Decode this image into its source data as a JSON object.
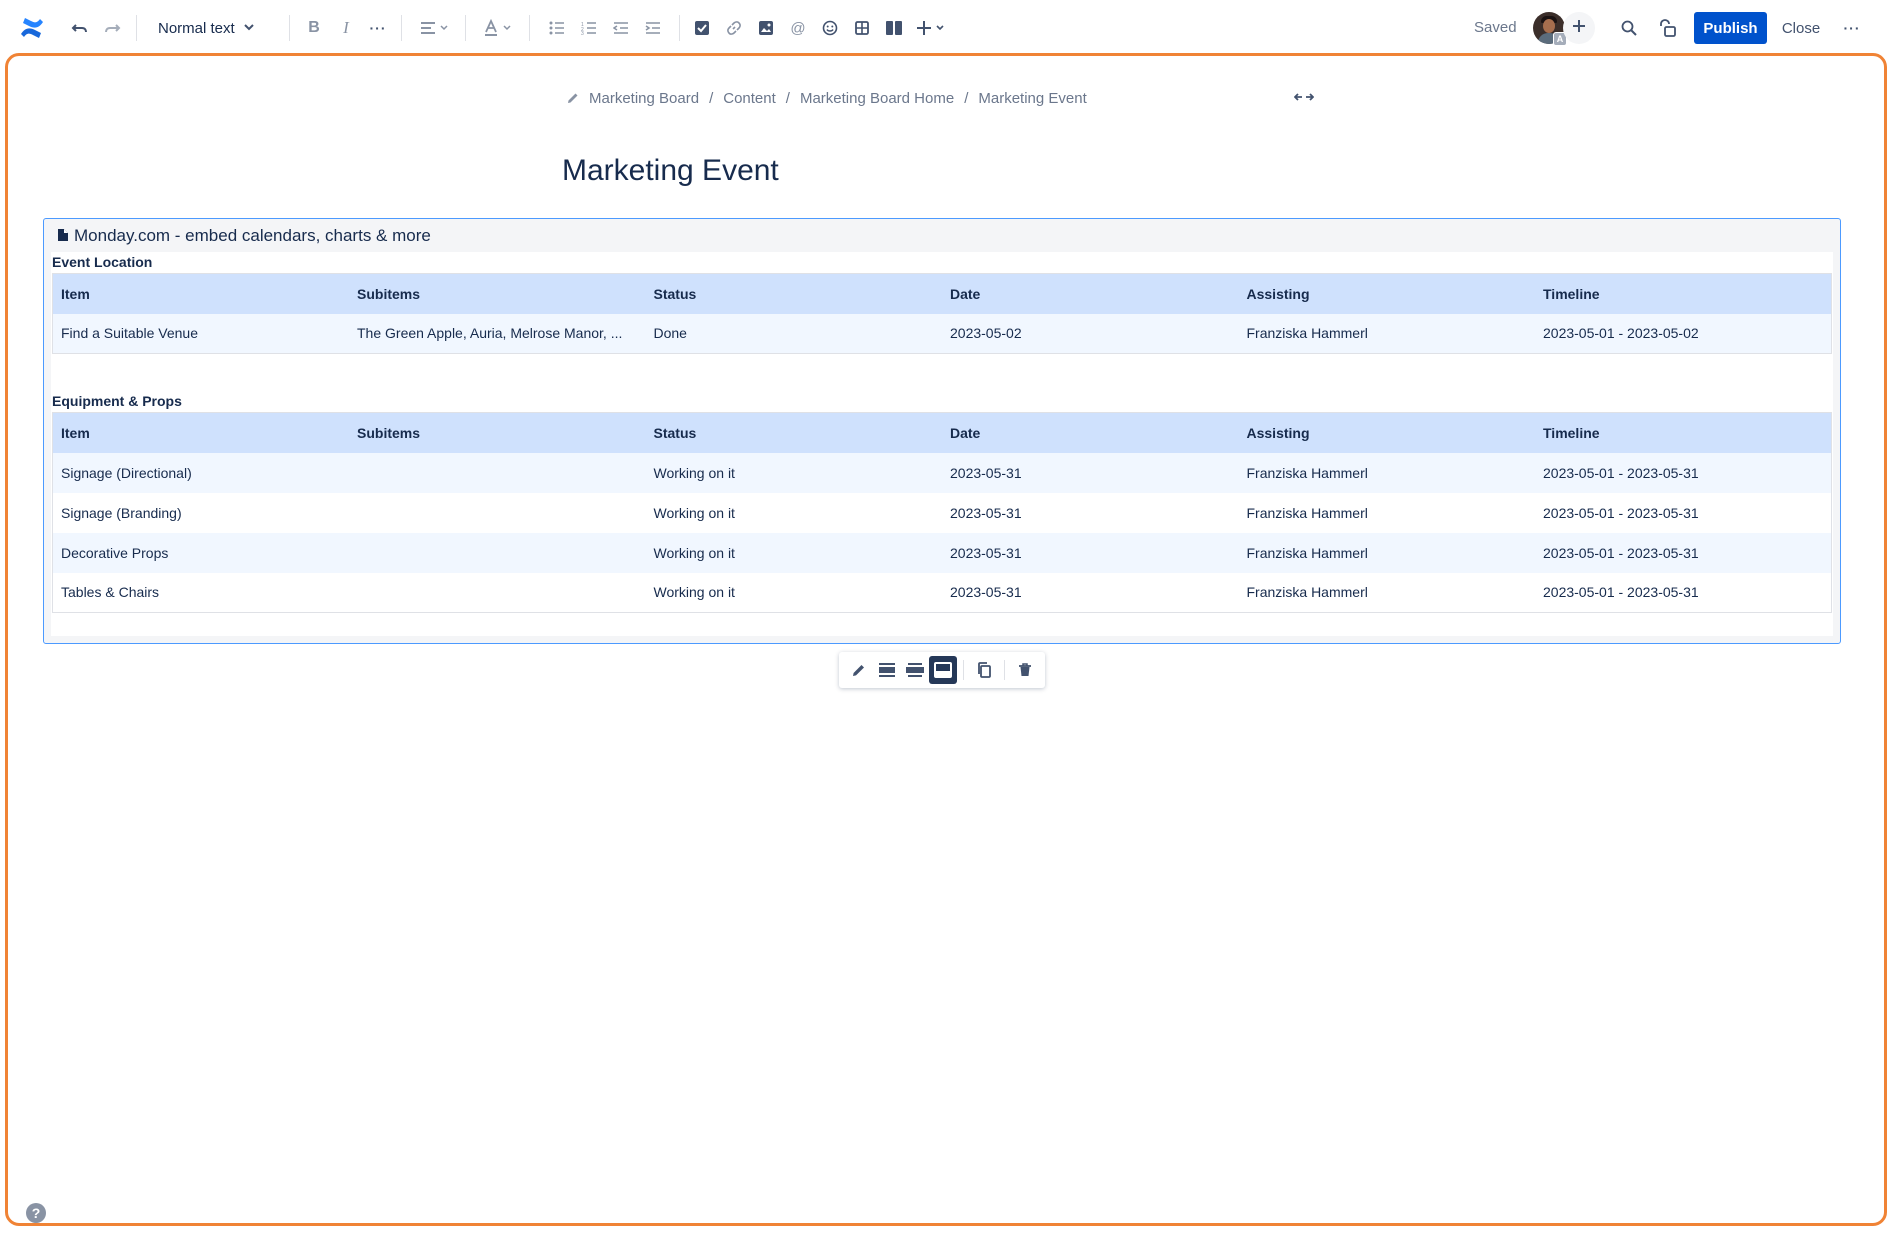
{
  "toolbar": {
    "text_style": "Normal text",
    "saved_label": "Saved",
    "publish_label": "Publish",
    "close_label": "Close",
    "avatar_badge": "A",
    "icons": [
      "confluence-logo-icon",
      "undo-icon",
      "redo-icon",
      "bold-icon",
      "italic-icon",
      "more-formatting-icon",
      "align-icon",
      "text-color-icon",
      "bullet-list-icon",
      "numbered-list-icon",
      "outdent-icon",
      "indent-icon",
      "task-icon",
      "link-icon",
      "image-icon",
      "mention-icon",
      "emoji-icon",
      "table-icon",
      "layout-icon",
      "insert-plus-icon",
      "search-icon",
      "restrictions-icon",
      "more-icon"
    ]
  },
  "breadcrumb": {
    "items": [
      "Marketing Board",
      "Content",
      "Marketing Board Home",
      "Marketing Event"
    ],
    "separator": "/"
  },
  "page": {
    "title": "Marketing Event"
  },
  "macro": {
    "title": "Monday.com - embed calendars, charts & more",
    "columns": [
      "Item",
      "Subitems",
      "Status",
      "Date",
      "Assisting",
      "Timeline"
    ],
    "sections": [
      {
        "name": "Event Location",
        "rows": [
          [
            "Find a Suitable Venue",
            "The Green Apple, Auria, Melrose Manor, ...",
            "Done",
            "2023-05-02",
            "Franziska Hammerl",
            "2023-05-01 - 2023-05-02"
          ]
        ]
      },
      {
        "name": "Equipment & Props",
        "rows": [
          [
            "Signage (Directional)",
            "",
            "Working on it",
            "2023-05-31",
            "Franziska Hammerl",
            "2023-05-01 - 2023-05-31"
          ],
          [
            "Signage (Branding)",
            "",
            "Working on it",
            "2023-05-31",
            "Franziska Hammerl",
            "2023-05-01 - 2023-05-31"
          ],
          [
            "Decorative Props",
            "",
            "Working on it",
            "2023-05-31",
            "Franziska Hammerl",
            "2023-05-01 - 2023-05-31"
          ],
          [
            "Tables & Chairs",
            "",
            "Working on it",
            "2023-05-31",
            "Franziska Hammerl",
            "2023-05-01 - 2023-05-31"
          ]
        ]
      }
    ]
  },
  "colors": {
    "accent": "#0052cc",
    "frame_highlight": "#f08335",
    "macro_border": "#4c9aff",
    "table_header": "#cfe1fd",
    "row_stripe": "#f1f7ff"
  },
  "help": {
    "label": "?"
  }
}
